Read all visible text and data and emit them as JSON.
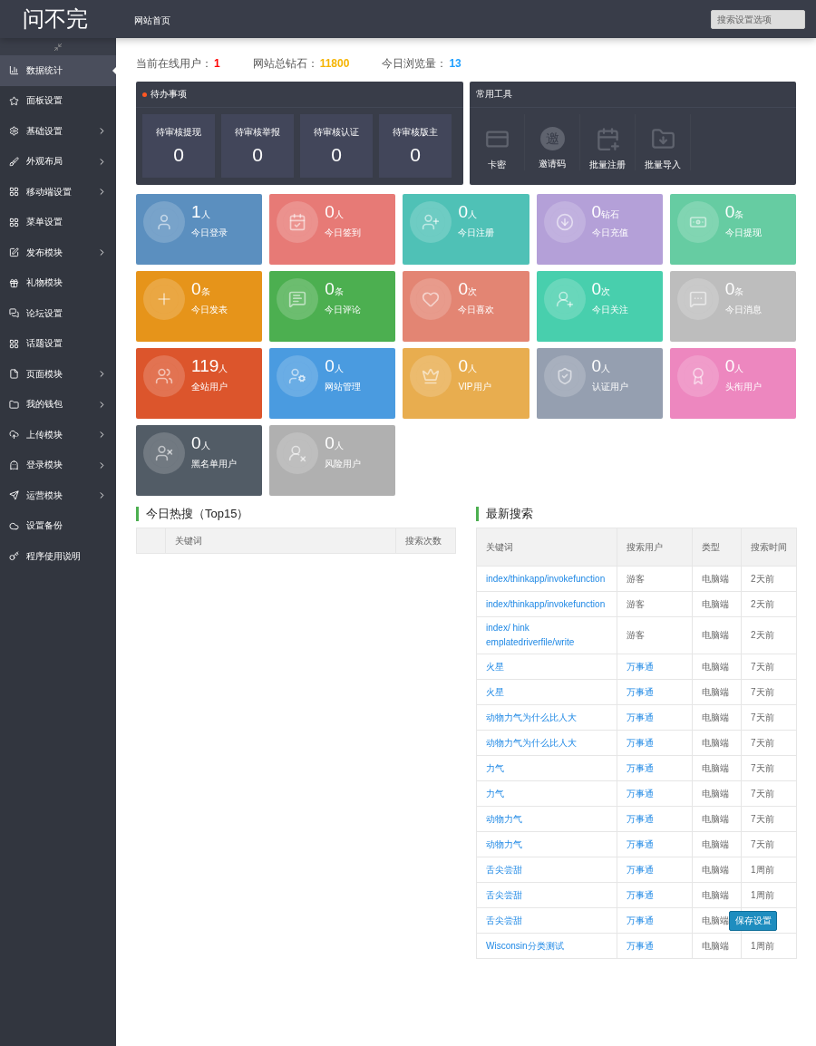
{
  "header": {
    "logo": "问不完",
    "nav_link": "网站首页",
    "search": {
      "placeholder": "搜索设置选项"
    }
  },
  "sidebar": {
    "items": [
      {
        "label": "数据统计",
        "selected": true,
        "has_children": false
      },
      {
        "label": "面板设置",
        "selected": false,
        "has_children": false
      },
      {
        "label": "基础设置",
        "selected": false,
        "has_children": true
      },
      {
        "label": "外观布局",
        "selected": false,
        "has_children": true
      },
      {
        "label": "移动端设置",
        "selected": false,
        "has_children": true
      },
      {
        "label": "菜单设置",
        "selected": false,
        "has_children": false
      },
      {
        "label": "发布模块",
        "selected": false,
        "has_children": true
      },
      {
        "label": "礼物模块",
        "selected": false,
        "has_children": false
      },
      {
        "label": "论坛设置",
        "selected": false,
        "has_children": false
      },
      {
        "label": "话题设置",
        "selected": false,
        "has_children": false
      },
      {
        "label": "页面模块",
        "selected": false,
        "has_children": true
      },
      {
        "label": "我的钱包",
        "selected": false,
        "has_children": true
      },
      {
        "label": "上传模块",
        "selected": false,
        "has_children": true
      },
      {
        "label": "登录模块",
        "selected": false,
        "has_children": true
      },
      {
        "label": "运营模块",
        "selected": false,
        "has_children": true
      },
      {
        "label": "设置备份",
        "selected": false,
        "has_children": false
      },
      {
        "label": "程序使用说明",
        "selected": false,
        "has_children": false
      }
    ]
  },
  "summary": [
    {
      "label": "当前在线用户：",
      "value": "1",
      "color": "#ff0000"
    },
    {
      "label": "网站总钻石：",
      "value": "11800",
      "color": "#f5b400"
    },
    {
      "label": "今日浏览量：",
      "value": "13",
      "color": "#1e9fff"
    }
  ],
  "pending": {
    "title": "待办事项",
    "items": [
      {
        "label": "待审核提现",
        "value": "0"
      },
      {
        "label": "待审核举报",
        "value": "0"
      },
      {
        "label": "待审核认证",
        "value": "0"
      },
      {
        "label": "待审核版主",
        "value": "0"
      }
    ]
  },
  "tools": {
    "title": "常用工具",
    "items": [
      {
        "label": "卡密"
      },
      {
        "label": "邀请码",
        "glyph": "邀"
      },
      {
        "label": "批量注册"
      },
      {
        "label": "批量导入"
      }
    ]
  },
  "tiles": [
    {
      "value": "1",
      "unit": "人",
      "label": "今日登录",
      "color": "#5b8fbf"
    },
    {
      "value": "0",
      "unit": "人",
      "label": "今日签到",
      "color": "#e77a76"
    },
    {
      "value": "0",
      "unit": "人",
      "label": "今日注册",
      "color": "#4fc1b6"
    },
    {
      "value": "0",
      "unit": "钻石",
      "label": "今日充值",
      "color": "#b4a0d8"
    },
    {
      "value": "0",
      "unit": "条",
      "label": "今日提现",
      "color": "#66cca2"
    },
    {
      "value": "0",
      "unit": "条",
      "label": "今日发表",
      "color": "#e6941a"
    },
    {
      "value": "0",
      "unit": "条",
      "label": "今日评论",
      "color": "#4caf50"
    },
    {
      "value": "0",
      "unit": "次",
      "label": "今日喜欢",
      "color": "#e38573"
    },
    {
      "value": "0",
      "unit": "次",
      "label": "今日关注",
      "color": "#48cfad"
    },
    {
      "value": "0",
      "unit": "条",
      "label": "今日消息",
      "color": "#bdbdbd"
    },
    {
      "value": "119",
      "unit": "人",
      "label": "全站用户",
      "color": "#dc552c"
    },
    {
      "value": "0",
      "unit": "人",
      "label": "网站管理",
      "color": "#4a9be0"
    },
    {
      "value": "0",
      "unit": "人",
      "label": "VIP用户",
      "color": "#e8ad4f"
    },
    {
      "value": "0",
      "unit": "人",
      "label": "认证用户",
      "color": "#959fb0"
    },
    {
      "value": "0",
      "unit": "人",
      "label": "头衔用户",
      "color": "#ed87bf"
    },
    {
      "value": "0",
      "unit": "人",
      "label": "黑名单用户",
      "color": "#525c66"
    },
    {
      "value": "0",
      "unit": "人",
      "label": "风险用户",
      "color": "#b0b0b0"
    }
  ],
  "hot_search": {
    "title": "今日热搜（Top15）",
    "columns": [
      "关键词",
      "搜索次数"
    ]
  },
  "latest_search": {
    "title": "最新搜索",
    "columns": [
      "关键词",
      "搜索用户",
      "类型",
      "搜索时间"
    ],
    "rows": [
      {
        "keyword": "index/thinkapp/invokefunction",
        "user": "游客",
        "user_link": false,
        "type": "电脑端",
        "time": "2天前"
      },
      {
        "keyword": "index/thinkapp/invokefunction",
        "user": "游客",
        "user_link": false,
        "type": "电脑端",
        "time": "2天前"
      },
      {
        "keyword": "index/ hink emplatedriverfile/write",
        "user": "游客",
        "user_link": false,
        "type": "电脑端",
        "time": "2天前"
      },
      {
        "keyword": "火星",
        "user": "万事通",
        "user_link": true,
        "type": "电脑端",
        "time": "7天前"
      },
      {
        "keyword": "火星",
        "user": "万事通",
        "user_link": true,
        "type": "电脑端",
        "time": "7天前"
      },
      {
        "keyword": "动物力气为什么比人大",
        "user": "万事通",
        "user_link": true,
        "type": "电脑端",
        "time": "7天前"
      },
      {
        "keyword": "动物力气为什么比人大",
        "user": "万事通",
        "user_link": true,
        "type": "电脑端",
        "time": "7天前"
      },
      {
        "keyword": "力气",
        "user": "万事通",
        "user_link": true,
        "type": "电脑端",
        "time": "7天前"
      },
      {
        "keyword": "力气",
        "user": "万事通",
        "user_link": true,
        "type": "电脑端",
        "time": "7天前"
      },
      {
        "keyword": "动物力气",
        "user": "万事通",
        "user_link": true,
        "type": "电脑端",
        "time": "7天前"
      },
      {
        "keyword": "动物力气",
        "user": "万事通",
        "user_link": true,
        "type": "电脑端",
        "time": "7天前"
      },
      {
        "keyword": "舌尖尝甜",
        "user": "万事通",
        "user_link": true,
        "type": "电脑端",
        "time": "1周前"
      },
      {
        "keyword": "舌尖尝甜",
        "user": "万事通",
        "user_link": true,
        "type": "电脑端",
        "time": "1周前"
      },
      {
        "keyword": "舌尖尝甜",
        "user": "万事通",
        "user_link": true,
        "type": "电脑端"
      },
      {
        "keyword": "Wisconsin分类测试",
        "user": "万事通",
        "user_link": true,
        "type": "电脑端",
        "time": "1周前"
      }
    ]
  },
  "save_button": "保存设置"
}
